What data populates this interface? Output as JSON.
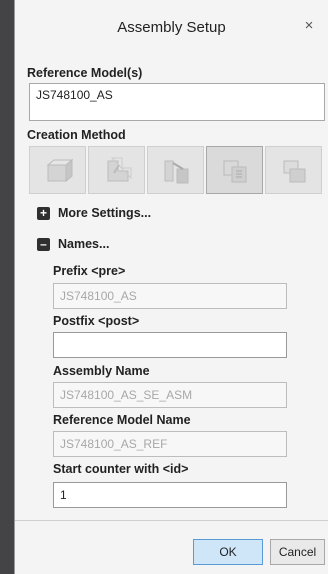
{
  "dialog": {
    "title": "Assembly Setup",
    "close_glyph": "×"
  },
  "reference_models": {
    "label": "Reference Model(s)",
    "value": "JS748100_AS"
  },
  "creation_method": {
    "label": "Creation Method",
    "options": [
      {
        "icon": "copy-part-icon",
        "state": "disabled"
      },
      {
        "icon": "shrinkwrap-icon",
        "state": "disabled"
      },
      {
        "icon": "split-icon",
        "state": "disabled"
      },
      {
        "icon": "assembly-reference-icon",
        "state": "selected"
      },
      {
        "icon": "merge-icon",
        "state": "disabled"
      }
    ]
  },
  "more_settings": {
    "toggle": "+",
    "label": "More Settings..."
  },
  "names": {
    "toggle": "–",
    "label": "Names...",
    "prefix_label": "Prefix <pre>",
    "prefix_value": "JS748100_AS",
    "postfix_label": "Postfix <post>",
    "postfix_value": "",
    "assembly_name_label": "Assembly Name",
    "assembly_name_value": "JS748100_AS_SE_ASM",
    "reference_model_name_label": "Reference Model Name",
    "reference_model_name_value": "JS748100_AS_REF",
    "start_counter_label": "Start counter  with <id>",
    "start_counter_value": "1"
  },
  "buttons": {
    "ok": "OK",
    "cancel": "Cancel"
  },
  "colors": {
    "ok_accent": "#5b9bd5",
    "dialog_bg": "#f4f4f4"
  }
}
